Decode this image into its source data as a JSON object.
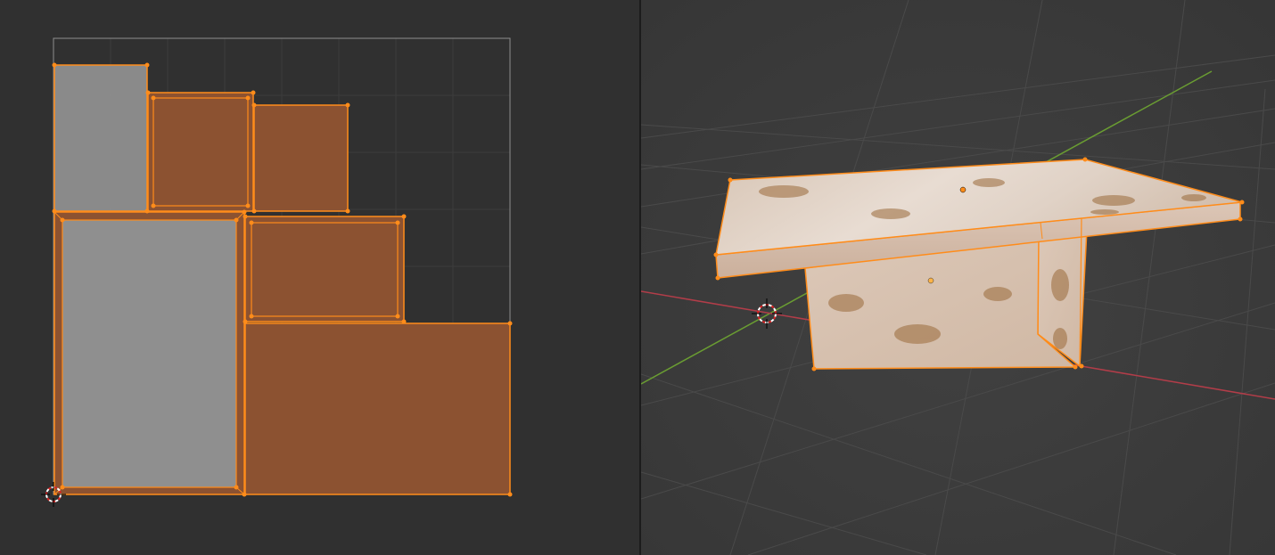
{
  "uv_editor": {
    "tile_border_color": "#8e8e8e",
    "grid_color": "#3d3d3d",
    "selected_edge_color": "#ff8c1a",
    "selected_face_color": "#8c5231",
    "unselected_face_color": "#8f8f8f",
    "islands": [
      "uv-island-1",
      "uv-island-2",
      "uv-island-3",
      "uv-island-4",
      "uv-island-5",
      "uv-island-6"
    ]
  },
  "viewport_3d": {
    "x_axis_color": "#b23d49",
    "y_axis_color": "#6a9d32",
    "selection_outline_color": "#ff8c1a",
    "object": "marble-table-mesh"
  },
  "icons": [
    "2d-cursor-icon",
    "3d-cursor-icon",
    "object-origin-icon"
  ]
}
